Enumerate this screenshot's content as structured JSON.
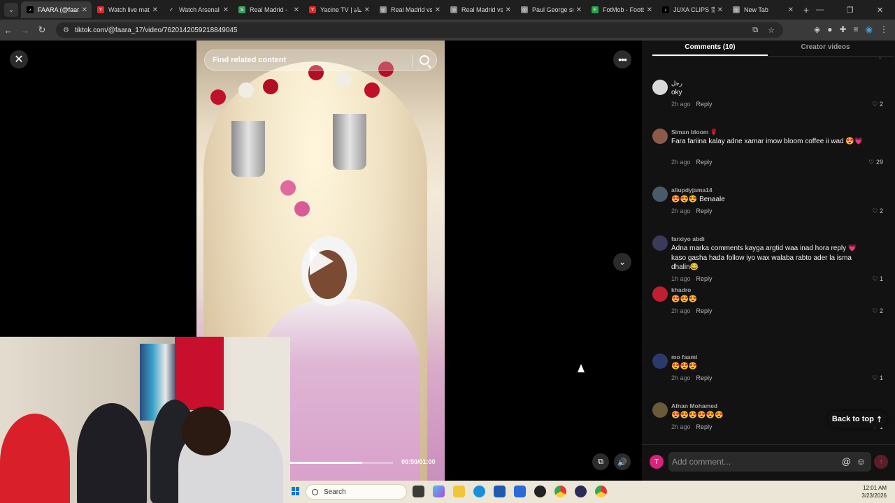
{
  "browser": {
    "tabs": [
      {
        "title": "FAARA (@faara",
        "color": "#000000",
        "glyph": "♪",
        "active": true
      },
      {
        "title": "Watch live mat",
        "color": "#e02a2a",
        "glyph": "Y",
        "active": false
      },
      {
        "title": "Watch Arsenal",
        "color": "#1f1f1f",
        "glyph": "✓",
        "active": false
      },
      {
        "title": "Real Madrid - ",
        "color": "#3aa35a",
        "glyph": "S",
        "active": false
      },
      {
        "title": "Yacine TV | قناة",
        "color": "#e02a2a",
        "glyph": "Y",
        "active": false
      },
      {
        "title": "Real Madrid vs",
        "color": "#888888",
        "glyph": "◎",
        "active": false
      },
      {
        "title": "Real Madrid vs",
        "color": "#888888",
        "glyph": "◎",
        "active": false
      },
      {
        "title": "Paul George su",
        "color": "#888888",
        "glyph": "◎",
        "active": false
      },
      {
        "title": "FotMob - Footb",
        "color": "#22a34a",
        "glyph": "F",
        "active": false
      },
      {
        "title": "JUXA CLIPS 🎬",
        "color": "#000000",
        "glyph": "♪",
        "active": false
      },
      {
        "title": "New Tab",
        "color": "#888888",
        "glyph": "◎",
        "active": false
      }
    ],
    "url": "tiktok.com/@faara_17/video/7620142059218849045"
  },
  "video": {
    "search_placeholder": "Find related content",
    "time": "00:50/01:00",
    "progress": 0.7
  },
  "panel": {
    "tab_comments": "Comments (10)",
    "tab_creator": "Creator videos",
    "back_to_top": "Back to top",
    "comment_placeholder": "Add comment...",
    "user_initial": "T",
    "reply_label": "Reply"
  },
  "comments": [
    {
      "user": "رجل",
      "text": "oky",
      "time": "2h ago",
      "likes": "2",
      "avatar": "#d9d9d9"
    },
    {
      "user": "Siman bloom 🌹",
      "text": "Fara fariina kalay adne xamar imow bloom coffee ii wad 😍💗",
      "time": "2h ago",
      "likes": "29",
      "avatar": "#8b5a4a"
    },
    {
      "user": "aliupdyjama14",
      "text": "😍😍😍 Benaale",
      "time": "2h ago",
      "likes": "2",
      "avatar": "#4a5a6a"
    },
    {
      "user": "farxiyo abdi",
      "text": "Adna marka comments kayga argtid waa inad hora reply 💗kaso gasha hada follow iyo wax walaba rabto ader la isma dhalin😂",
      "time": "1h ago",
      "likes": "1",
      "avatar": "#3a3a5a"
    },
    {
      "user": "khadro",
      "text": "😍😍😍",
      "time": "2h ago",
      "likes": "2",
      "avatar": "#c01f2f"
    },
    {
      "user": "mo faami",
      "text": "😍😍😍",
      "time": "2h ago",
      "likes": "1",
      "avatar": "#2a3a6a"
    },
    {
      "user": "Afnan Mohamed",
      "text": "😍😍😍😍😍😍",
      "time": "2h ago",
      "likes": "1",
      "avatar": "#6a5a3a"
    }
  ],
  "taskbar": {
    "search_label": "Search",
    "time": "12:01 AM",
    "date": "3/23/2026"
  }
}
